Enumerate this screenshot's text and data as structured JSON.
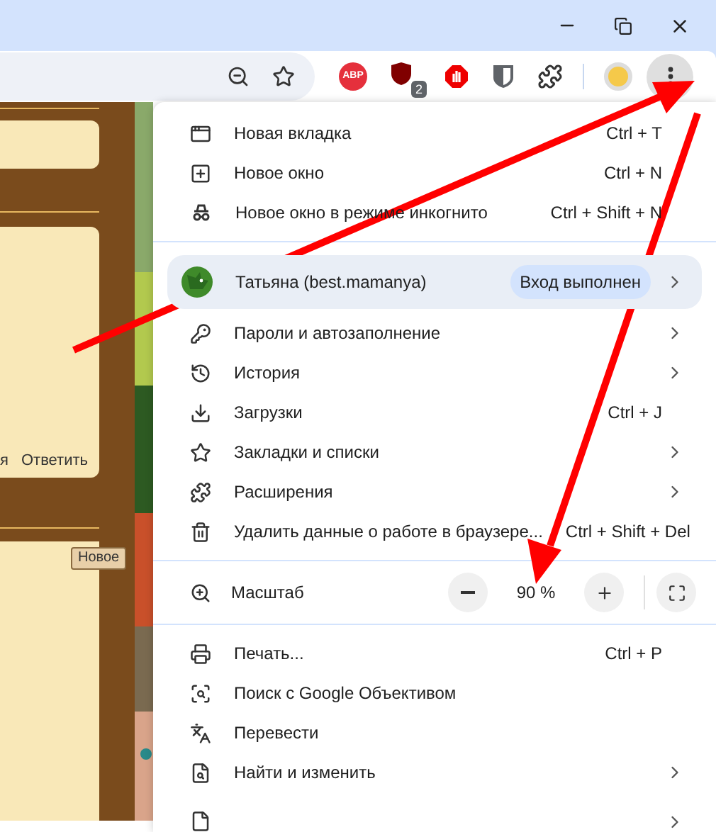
{
  "toolbar": {
    "extensions": [
      {
        "kind": "abp",
        "label": "ABP"
      },
      {
        "kind": "ublock",
        "badge": "2"
      },
      {
        "kind": "hand"
      },
      {
        "kind": "shield"
      },
      {
        "kind": "puzzle"
      }
    ]
  },
  "page": {
    "reply_fragment": "я",
    "reply_link": "Ответить",
    "new_button": "Новое"
  },
  "menu": [
    {
      "kind": "item",
      "label": "Новая вкладка",
      "shortcut": "Ctrl + T",
      "has_submenu": false
    },
    {
      "kind": "item",
      "label": "Новое окно",
      "shortcut": "Ctrl + N",
      "has_submenu": false
    },
    {
      "kind": "item",
      "label": "Новое окно в режиме инкогнито",
      "shortcut": "Ctrl + Shift + N",
      "has_submenu": false
    },
    {
      "kind": "divider"
    },
    {
      "kind": "profile",
      "label": "Татьяна (best.mamanya)",
      "status": "Вход выполнен",
      "has_submenu": true
    },
    {
      "kind": "item",
      "label": "Пароли и автозаполнение",
      "has_submenu": true
    },
    {
      "kind": "item",
      "label": "История",
      "has_submenu": true
    },
    {
      "kind": "item",
      "label": "Загрузки",
      "shortcut": "Ctrl + J",
      "has_submenu": false
    },
    {
      "kind": "item",
      "label": "Закладки и списки",
      "has_submenu": true
    },
    {
      "kind": "item",
      "label": "Расширения",
      "has_submenu": true
    },
    {
      "kind": "item",
      "label": "Удалить данные о работе в браузере...",
      "shortcut": "Ctrl + Shift + Del",
      "has_submenu": false
    },
    {
      "kind": "divider"
    },
    {
      "kind": "zoom",
      "label": "Масштаб",
      "value": "90 %"
    },
    {
      "kind": "divider"
    },
    {
      "kind": "item",
      "label": "Печать...",
      "shortcut": "Ctrl + P",
      "has_submenu": false
    },
    {
      "kind": "item",
      "label": "Поиск с Google Объективом",
      "has_submenu": false
    },
    {
      "kind": "item",
      "label": "Перевести",
      "has_submenu": false
    },
    {
      "kind": "item",
      "label": "Найти и изменить",
      "has_submenu": true
    },
    {
      "kind": "partial",
      "has_submenu": true
    }
  ]
}
